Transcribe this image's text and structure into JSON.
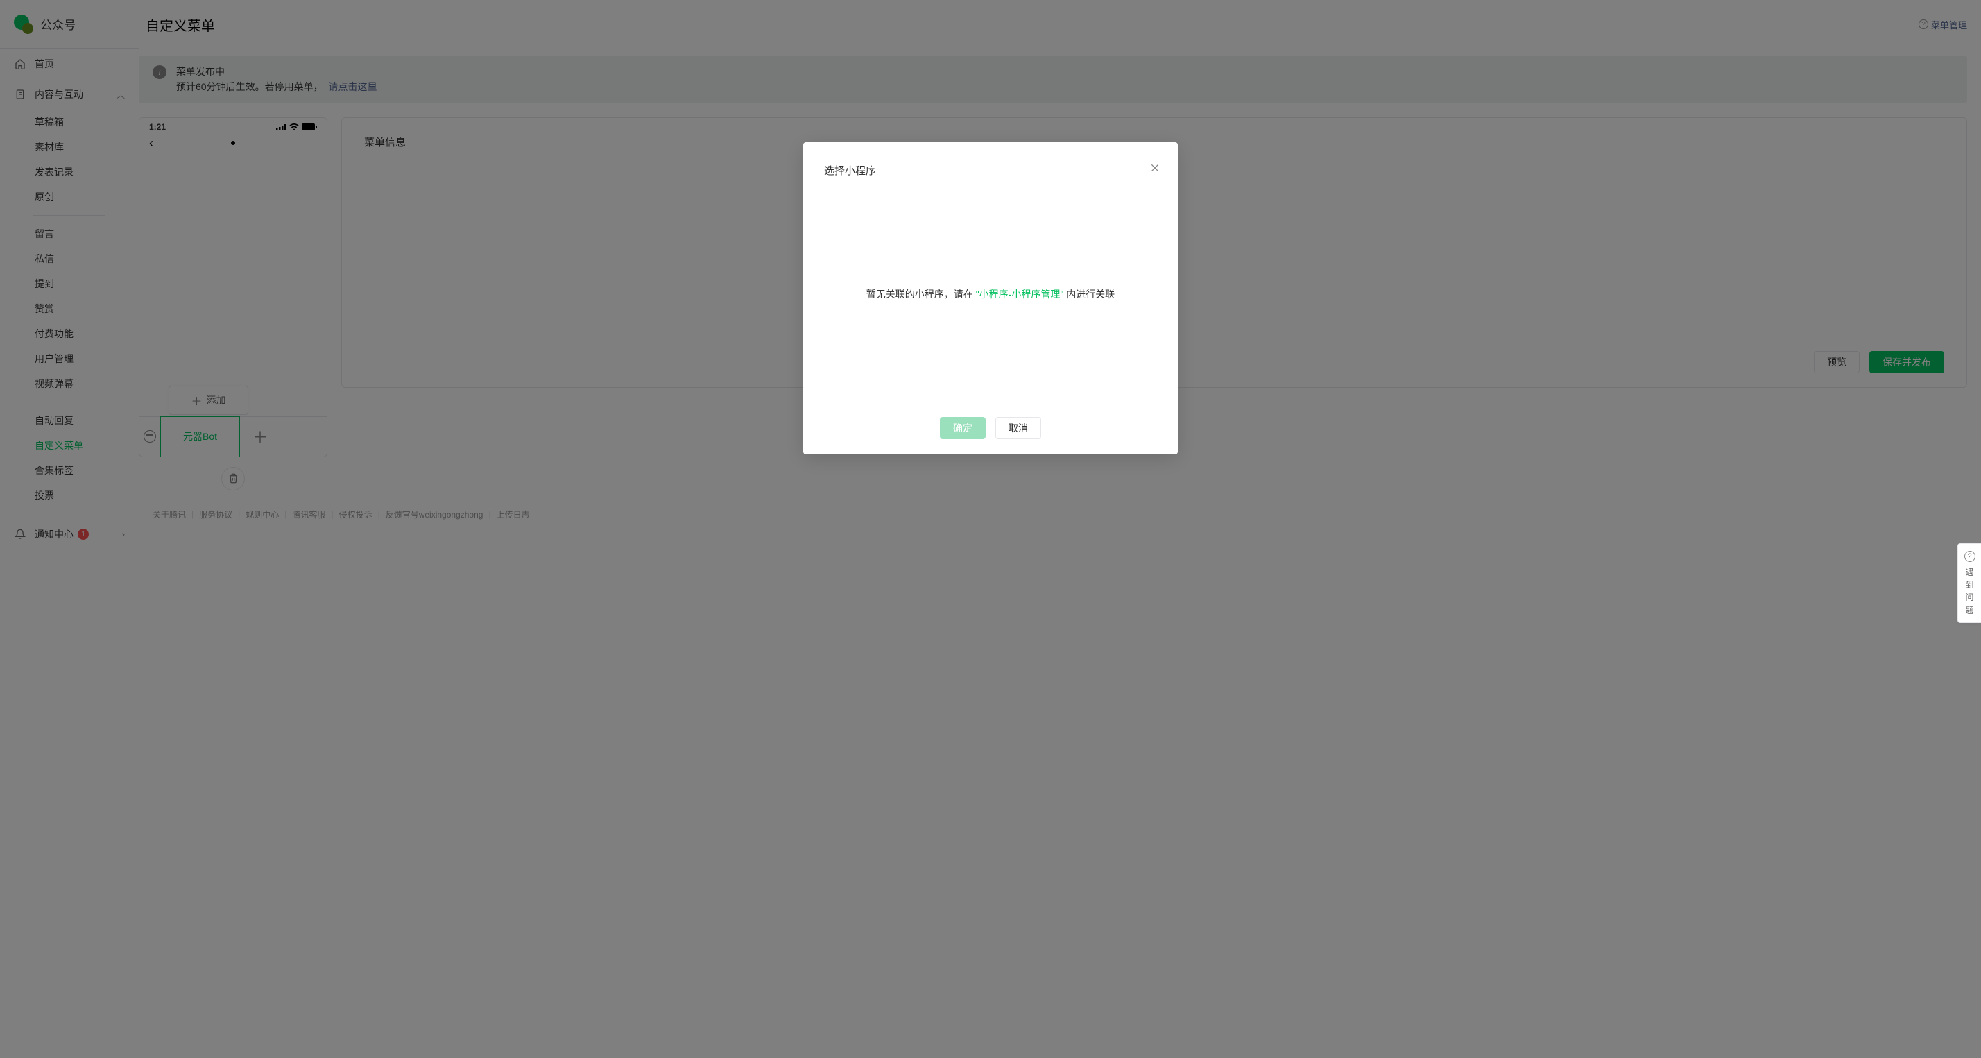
{
  "app": {
    "name": "公众号"
  },
  "sidebar": {
    "home": "首页",
    "content_section": "内容与互动",
    "items": [
      "草稿箱",
      "素材库",
      "发表记录",
      "原创",
      "留言",
      "私信",
      "提到",
      "赞赏",
      "付费功能",
      "用户管理",
      "视频弹幕",
      "自动回复",
      "自定义菜单",
      "合集标签",
      "投票"
    ],
    "notice": "通知中心",
    "notice_count": "1"
  },
  "page": {
    "title": "自定义菜单",
    "manage_link": "菜单管理"
  },
  "alert": {
    "line1": "菜单发布中",
    "line2_a": "预计60分钟后生效。若停用菜单，",
    "line2_link": "请点击这里"
  },
  "phone": {
    "time": "1:21",
    "submenu_add": "添加",
    "menu_item": "元器Bot"
  },
  "info": {
    "title": "菜单信息",
    "preview": "预览",
    "save_publish": "保存并发布"
  },
  "modal": {
    "title": "选择小程序",
    "empty_a": "暂无关联的小程序，请在",
    "empty_link": "\"小程序-小程序管理\"",
    "empty_b": "内进行关联",
    "ok": "确定",
    "cancel": "取消"
  },
  "float_help": [
    "遇",
    "到",
    "问",
    "题"
  ],
  "footer": [
    "关于腾讯",
    "服务协议",
    "规则中心",
    "腾讯客服",
    "侵权投诉",
    "反馈官号weixingongzhong",
    "上传日志"
  ]
}
